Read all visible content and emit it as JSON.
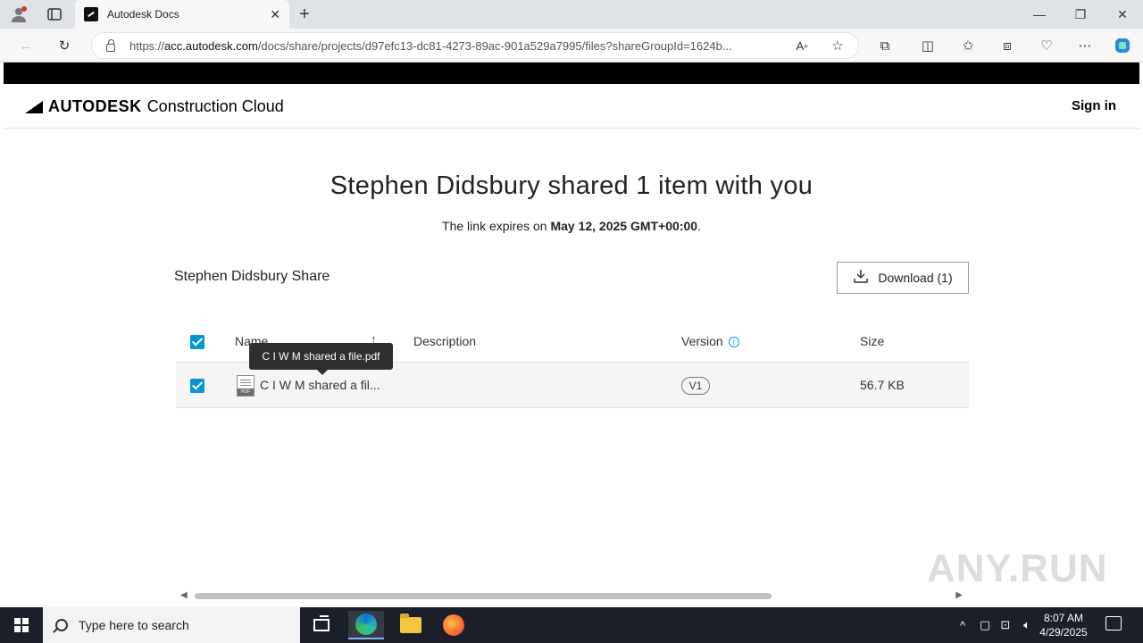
{
  "browser": {
    "tab_title": "Autodesk Docs",
    "url_prefix": "https://",
    "url_host": "acc.autodesk.com",
    "url_path": "/docs/share/projects/d97efc13-dc81-4273-89ac-901a529a7995/files?shareGroupId=1624b..."
  },
  "header": {
    "brand": "AUTODESK",
    "product": "Construction Cloud",
    "signin_label": "Sign in"
  },
  "share": {
    "title": "Stephen Didsbury shared 1 item with you",
    "expiry_prefix": "The link expires on ",
    "expiry_date": "May 12, 2025 GMT+00:00",
    "expiry_suffix": ".",
    "share_name": "Stephen Didsbury Share",
    "download_label": "Download (1)"
  },
  "table": {
    "columns": {
      "name": "Name",
      "description": "Description",
      "version": "Version",
      "size": "Size"
    },
    "rows": [
      {
        "name": "C I W M shared a fil...",
        "description": "",
        "version": "V1",
        "size": "56.7 KB"
      }
    ],
    "tooltip": "C I W M shared a file.pdf"
  },
  "watermark": "ANY.RUN",
  "taskbar": {
    "search_placeholder": "Type here to search",
    "time": "8:07 AM",
    "date": "4/29/2025"
  },
  "colors": {
    "accent": "#0696d7",
    "taskbar": "#1b1f2a"
  }
}
